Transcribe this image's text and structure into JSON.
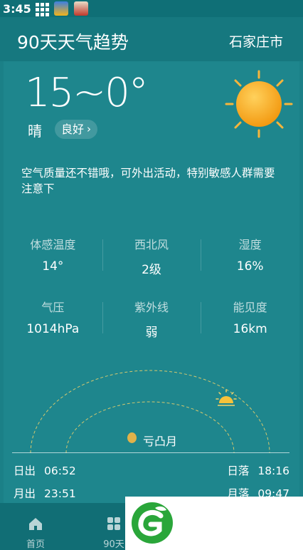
{
  "status_bar": {
    "time": "3:45"
  },
  "header": {
    "title": "90天天气趋势",
    "city": "石家庄市"
  },
  "weather": {
    "temp_range": "15~0°",
    "condition": "晴",
    "aqi_label": "良好",
    "aqi_chevron": "›",
    "description": "空气质量还不错哦，可外出活动，特别敏感人群需要注意下"
  },
  "metrics": [
    [
      {
        "label": "体感温度",
        "value": "14°"
      },
      {
        "label": "西北风",
        "value": "2级"
      },
      {
        "label": "湿度",
        "value": "16%"
      }
    ],
    [
      {
        "label": "气压",
        "value": "1014hPa"
      },
      {
        "label": "紫外线",
        "value": "弱"
      },
      {
        "label": "能见度",
        "value": "16km"
      }
    ]
  ],
  "astro": {
    "moon_phase": "亏凸月",
    "sunrise_label": "日出",
    "sunrise": "06:52",
    "sunset_label": "日落",
    "sunset": "18:16",
    "moonrise_label": "月出",
    "moonrise": "23:51",
    "moonset_label": "月落",
    "moonset": "09:47"
  },
  "nav": {
    "home": "首页",
    "ninety": "90天"
  },
  "colors": {
    "background": "#1b8087",
    "card": "#1e868d",
    "sun": "#f7a823",
    "arc": "#f3d36a"
  }
}
